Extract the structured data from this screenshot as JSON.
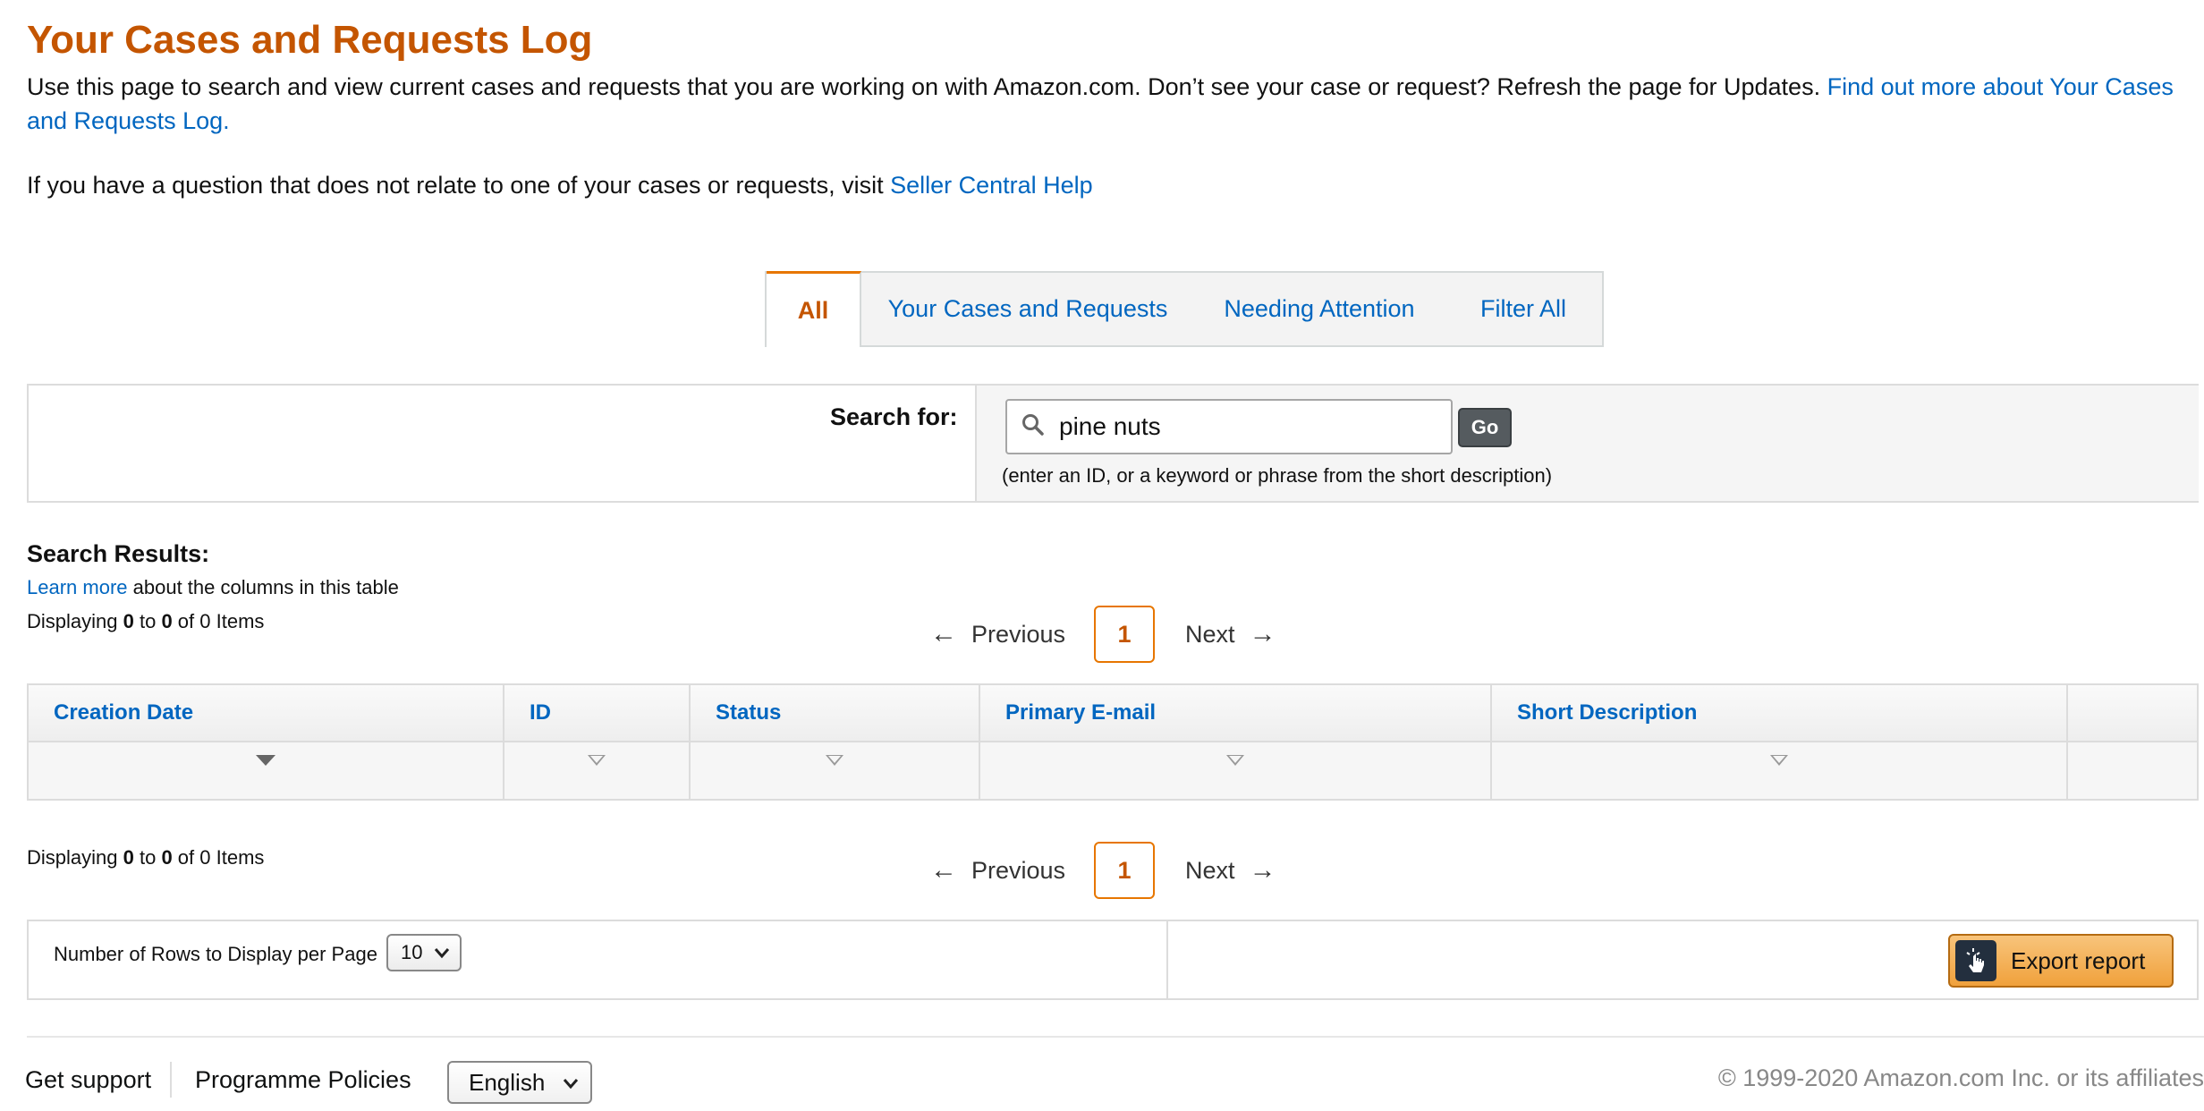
{
  "header": {
    "title": "Your Cases and Requests Log",
    "intro_text": "Use this page to search and view current cases and requests that you are working on with Amazon.com. Don’t see your case or request? Refresh the page for Updates. ",
    "intro_link": "Find out more about Your Cases and Requests Log.",
    "question_text": "If you have a question that does not relate to one of your cases or requests, visit ",
    "question_link": "Seller Central Help"
  },
  "tabs": [
    {
      "label": "All",
      "active": true
    },
    {
      "label": "Your Cases and Requests",
      "active": false
    },
    {
      "label": "Needing Attention",
      "active": false
    },
    {
      "label": "Filter All",
      "active": false
    }
  ],
  "search": {
    "label": "Search for:",
    "value": "pine nuts",
    "go_label": "Go",
    "hint": "(enter an ID, or a keyword or phrase from the short description)"
  },
  "results": {
    "title": "Search Results:",
    "learn_link": "Learn more",
    "learn_text": " about the columns in this table",
    "displaying_prefix": "Displaying ",
    "from": "0",
    "to_word": " to ",
    "to": "0",
    "of_text": " of 0 Items"
  },
  "pagination": {
    "prev_label": "Previous",
    "next_label": "Next",
    "current_page": "1"
  },
  "table": {
    "columns": [
      "Creation Date",
      "ID",
      "Status",
      "Primary E-mail",
      "Short Description",
      ""
    ]
  },
  "rows_per_page": {
    "label": "Number of Rows to Display per Page",
    "value": "10"
  },
  "export": {
    "label": "Export report",
    "icon": "cursor-click-icon"
  },
  "footer": {
    "support": "Get support",
    "policies": "Programme Policies",
    "language": "English",
    "copyright": "© 1999-2020 Amazon.com Inc. or its affiliates"
  },
  "colors": {
    "title": "#c45500",
    "link": "#0066c0",
    "accent": "#e77600"
  }
}
